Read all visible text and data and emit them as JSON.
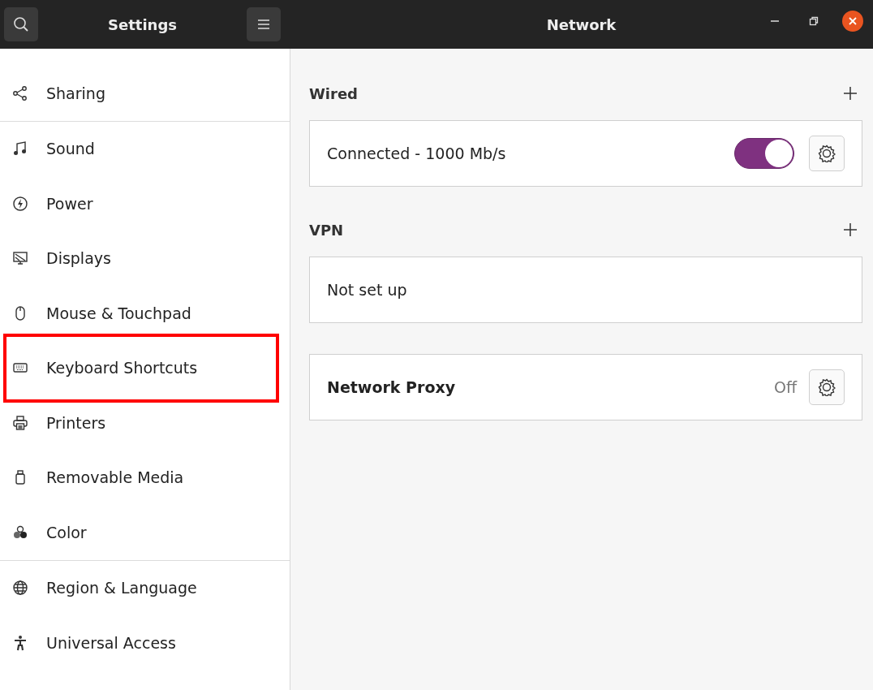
{
  "sidebar": {
    "title": "Settings",
    "sections": [
      {
        "items": [
          {
            "label": "Sharing",
            "selected": false,
            "highlighted": false
          }
        ]
      },
      {
        "items": [
          {
            "label": "Sound",
            "selected": false,
            "highlighted": false
          },
          {
            "label": "Power",
            "selected": false,
            "highlighted": false
          },
          {
            "label": "Displays",
            "selected": false,
            "highlighted": false
          },
          {
            "label": "Mouse & Touchpad",
            "selected": false,
            "highlighted": false
          },
          {
            "label": "Keyboard Shortcuts",
            "selected": false,
            "highlighted": true
          },
          {
            "label": "Printers",
            "selected": false,
            "highlighted": false
          },
          {
            "label": "Removable Media",
            "selected": false,
            "highlighted": false
          },
          {
            "label": "Color",
            "selected": false,
            "highlighted": false
          }
        ]
      },
      {
        "items": [
          {
            "label": "Region & Language",
            "selected": false,
            "highlighted": false
          },
          {
            "label": "Universal Access",
            "selected": false,
            "highlighted": false
          }
        ]
      }
    ]
  },
  "window": {
    "title": "Network"
  },
  "sections": [
    {
      "heading": "Wired",
      "rows": [
        {
          "kind": "switch",
          "label": "Connected - 1000 Mb/s",
          "on": true
        }
      ]
    },
    {
      "heading": "VPN",
      "rows": [
        {
          "kind": "plain",
          "label": "Not set up"
        }
      ]
    },
    {
      "rows": [
        {
          "kind": "proxy",
          "label": "Network Proxy",
          "status": "Off"
        }
      ]
    }
  ]
}
